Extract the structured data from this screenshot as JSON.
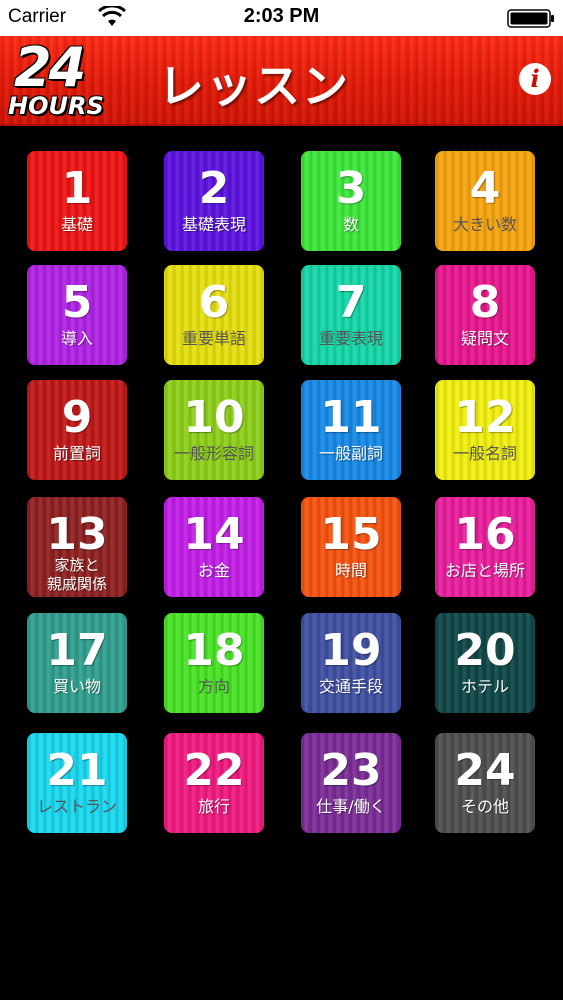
{
  "status_bar": {
    "carrier": "Carrier",
    "time": "2:03 PM"
  },
  "header": {
    "logo_number": "24",
    "logo_text": "HOURS",
    "title": "レッスン",
    "info_label": "i",
    "color": "#e51a08"
  },
  "lessons": [
    {
      "number": "1",
      "label": "基礎",
      "color": "#f01212"
    },
    {
      "number": "2",
      "label": "基礎表現",
      "color": "#5a11e0"
    },
    {
      "number": "3",
      "label": "数",
      "color": "#3ce83a"
    },
    {
      "number": "4",
      "label": "大きい数",
      "color": "#f7a40d"
    },
    {
      "number": "5",
      "label": "導入",
      "color": "#b020e6"
    },
    {
      "number": "6",
      "label": "重要単語",
      "color": "#e6e00e"
    },
    {
      "number": "7",
      "label": "重要表現",
      "color": "#13d7a8"
    },
    {
      "number": "8",
      "label": "疑問文",
      "color": "#e8148e"
    },
    {
      "number": "9",
      "label": "前置詞",
      "color": "#c01716"
    },
    {
      "number": "10",
      "label": "一般形容詞",
      "color": "#8ed018"
    },
    {
      "number": "11",
      "label": "一般副詞",
      "color": "#1589e8"
    },
    {
      "number": "12",
      "label": "一般名詞",
      "color": "#f1f00e"
    },
    {
      "number": "13",
      "label_line1": "家族と",
      "label_line2": "親戚関係",
      "color": "#8e1f1f"
    },
    {
      "number": "14",
      "label": "お金",
      "color": "#c21ce8"
    },
    {
      "number": "15",
      "label": "時間",
      "color": "#f7510e"
    },
    {
      "number": "16",
      "label": "お店と場所",
      "color": "#ea1c9d"
    },
    {
      "number": "17",
      "label": "買い物",
      "color": "#2f9f8e"
    },
    {
      "number": "18",
      "label": "方向",
      "color": "#48e424"
    },
    {
      "number": "19",
      "label": "交通手段",
      "color": "#3e4fa3"
    },
    {
      "number": "20",
      "label": "ホテル",
      "color": "#0e4747"
    },
    {
      "number": "21",
      "label": "レストラン",
      "color": "#17d8ef"
    },
    {
      "number": "22",
      "label": "旅行",
      "color": "#f21880"
    },
    {
      "number": "23",
      "label": "仕事/働く",
      "color": "#7a2b96"
    },
    {
      "number": "24",
      "label": "その他",
      "color": "#4e4e4e"
    }
  ]
}
